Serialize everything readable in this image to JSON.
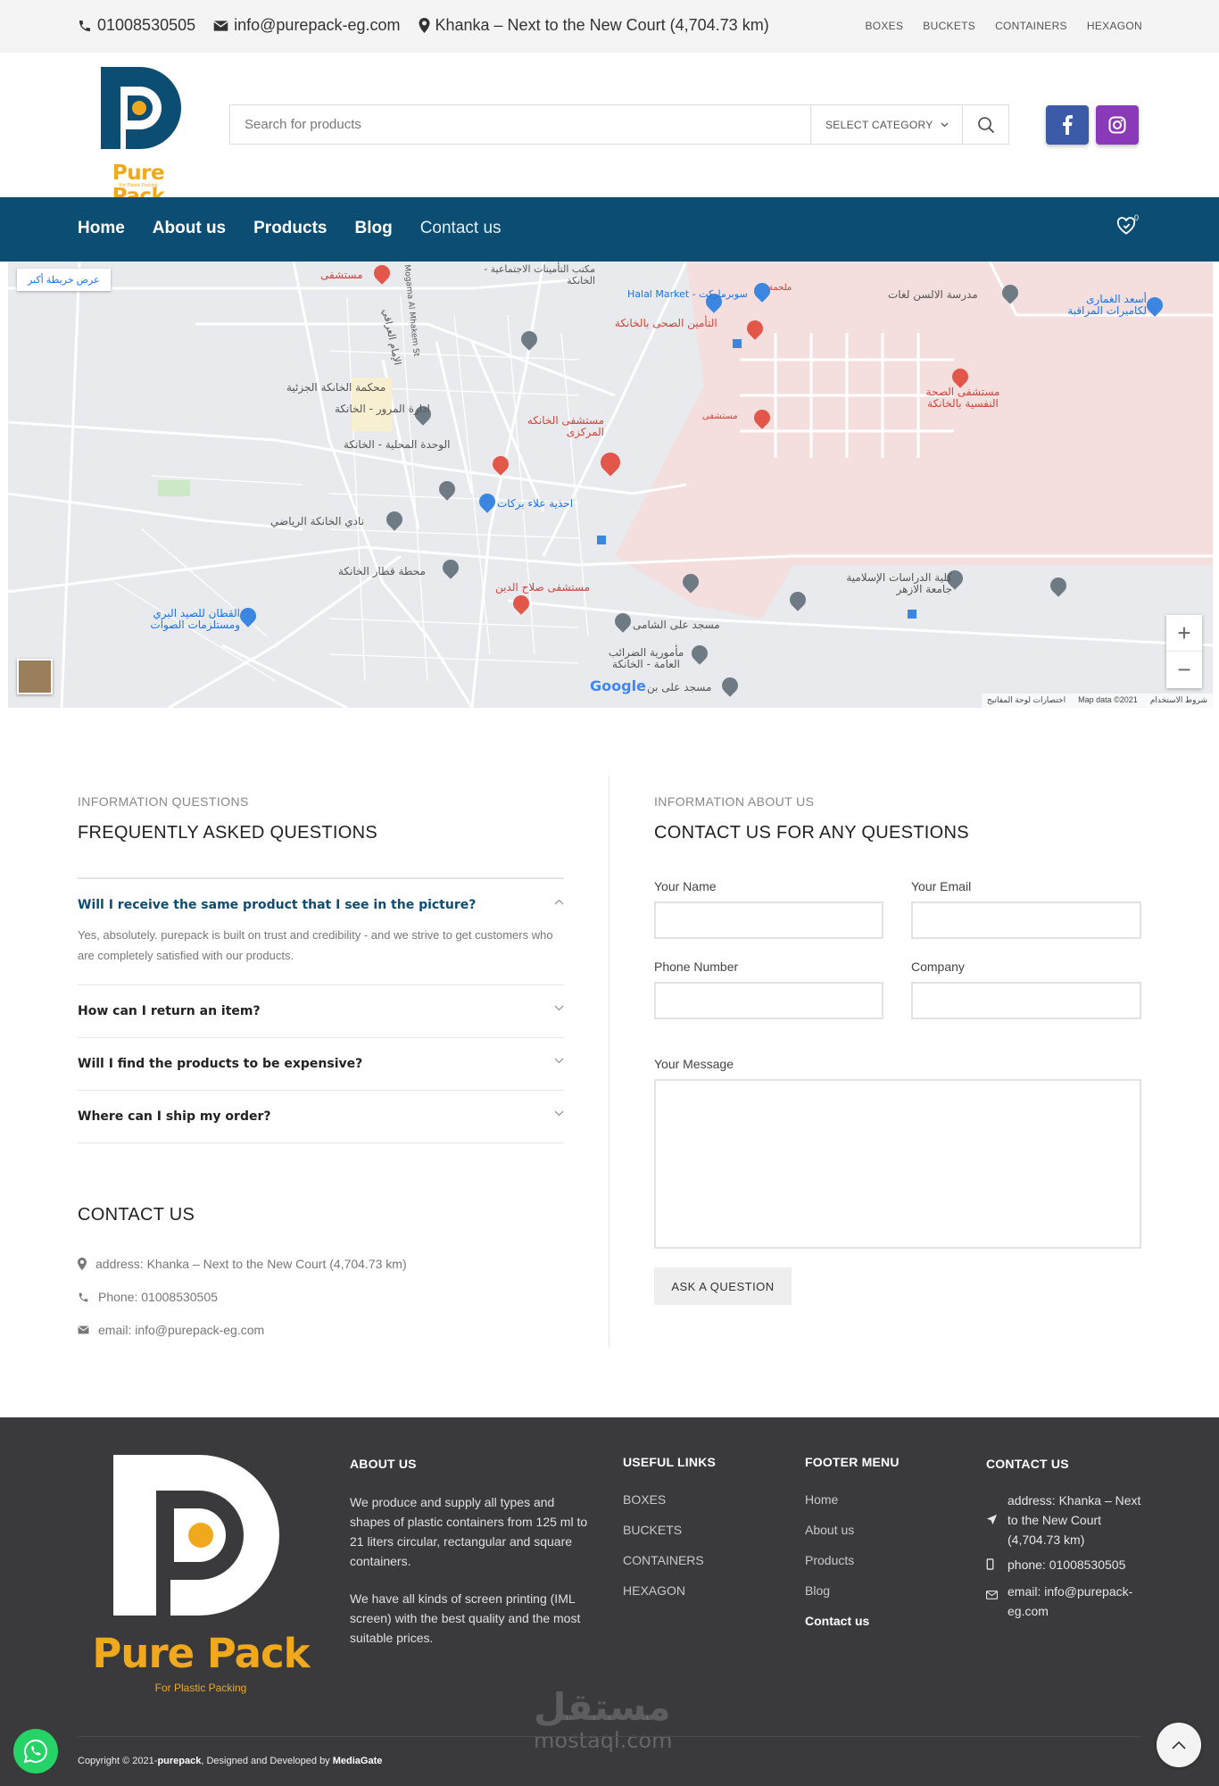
{
  "topbar": {
    "phone": "01008530505",
    "email": "info@purepack-eg.com",
    "location": "Khanka – Next to the New Court (4,704.73 km)",
    "links": [
      "BOXES",
      "BUCKETS",
      "CONTAINERS",
      "HEXAGON"
    ]
  },
  "header": {
    "logo_text": "Pure Pack",
    "logo_tagline": "For Plastic Packing",
    "search_placeholder": "Search for products",
    "category_label": "SELECT CATEGORY"
  },
  "nav": {
    "items": [
      "Home",
      "About us",
      "Products",
      "Blog",
      "Contact us"
    ],
    "wishlist_count": "0"
  },
  "map": {
    "view_larger": "عرض خريطة أكبر",
    "labels": {
      "hospital_top": "مستشفى",
      "insurance_office": "مكتب التأمينات الاجتماعية - الخانكة",
      "halal_market": "Halal Market - سوبرماركت",
      "butcher": "ملحمة",
      "tamin_hospital": "التأمين الصحى بالخانكة",
      "alsun_school": "مدرسة الالسن لغات",
      "ghamri": "أسعد الغمارى لكاميرات المراقبة",
      "court": "محكمة الخانكة الجزئية",
      "traffic": "ادارة المرور - الخانكة",
      "local_unit": "الوحدة المحلية - الخانكة",
      "central_hospital": "مستشفى الخانكه المركزى",
      "alaa_barakat": "احذية علاء بركات",
      "sports_club": "نادي الخانكة الرياضي",
      "hospital_mid": "مستشفى",
      "mental_hospital": "مستشفى الصحة النفسية بالخانكة",
      "train_station": "محطة قطار الخانكة",
      "salah_hospital": "مستشفى صلاح الدين",
      "azhar_college": "كلية الدراسات الإسلامية جامعة الازهر",
      "qattan": "القطان للصيد البري ومستلزمات الصوات",
      "shami_mosque": "مسجد على الشامى",
      "tax_office": "مأمورية الضرائب العامة - الخانكة",
      "ali_mosque": "مسجد على بن",
      "street_imam": "الإمام العراقي",
      "street_mogama": "Mogama Al Mhakem St"
    },
    "attribution": [
      "شروط الاستخدام",
      "Map data ©2021",
      "اختصارات لوحة المفاتيح"
    ],
    "google": "Google"
  },
  "faq": {
    "subtitle": "INFORMATION QUESTIONS",
    "title": "FREQUENTLY ASKED QUESTIONS",
    "items": [
      {
        "q": "Will I receive the same product that I see in the picture?",
        "a": "Yes, absolutely. purepack is built on trust and credibility - and we strive to get customers who are completely satisfied with our products."
      },
      {
        "q": "How can I return an item?"
      },
      {
        "q": "Will I find the products to be expensive?"
      },
      {
        "q": "Where can I ship my order?"
      }
    ]
  },
  "contact": {
    "title": "CONTACT US",
    "address": "address: Khanka – Next to the New Court (4,704.73 km)",
    "phone": "Phone: 01008530505",
    "email": "email: info@purepack-eg.com"
  },
  "form": {
    "subtitle": "INFORMATION ABOUT US",
    "title": "CONTACT US FOR ANY QUESTIONS",
    "name_label": "Your Name",
    "email_label": "Your Email",
    "phone_label": "Phone Number",
    "company_label": "Company",
    "message_label": "Your Message",
    "submit": "ASK A QUESTION"
  },
  "footer": {
    "brand": "Pure Pack",
    "tagline": "For Plastic Packing",
    "about_title": "ABOUT US",
    "about_p1": "We produce and supply all types and shapes of plastic containers from 125 ml to 21 liters circular, rectangular and square containers.",
    "about_p2": "We have all kinds of screen printing (IML screen) with the best quality and the most suitable prices.",
    "useful_title": "USEFUL LINKS",
    "useful_links": [
      "BOXES",
      "BUCKETS",
      "CONTAINERS",
      "HEXAGON"
    ],
    "menu_title": "FOOTER MENU",
    "menu_links": [
      "Home",
      "About us",
      "Products",
      "Blog",
      "Contact us"
    ],
    "contact_title": "CONTACT US",
    "contact_address": "address: Khanka – Next to the New Court (4,704.73 km)",
    "contact_phone": "phone: 01008530505",
    "contact_email": "email: info@purepack-eg.com",
    "copyright_prefix": "Copyright © 2021-",
    "copyright_brand": "purepack",
    "copyright_mid": ", Designed and Developed by ",
    "copyright_dev": "MediaGate",
    "watermark_ar": "مستقل",
    "watermark_en": "mostaql.com"
  },
  "colors": {
    "brand_blue": "#0b4d73",
    "brand_orange": "#f0a81d",
    "facebook": "#3b5ba8",
    "instagram": "#8a3ab9",
    "footer_bg": "#3a3a3c"
  }
}
